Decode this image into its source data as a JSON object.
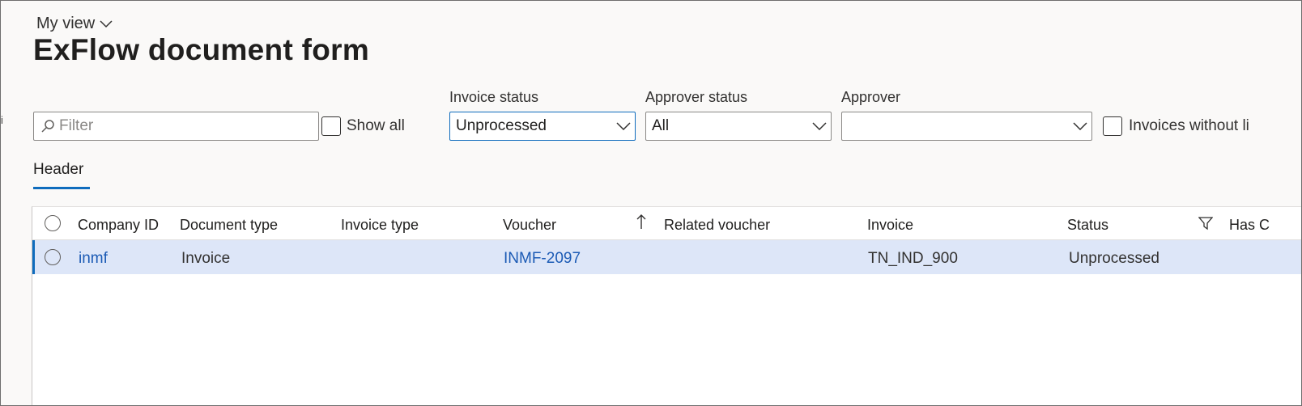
{
  "view_selector": {
    "label": "My view"
  },
  "page_title": "ExFlow document form",
  "filter": {
    "placeholder": "Filter"
  },
  "show_all": {
    "label": "Show all"
  },
  "invoice_status": {
    "label": "Invoice status",
    "value": "Unprocessed"
  },
  "approver_status": {
    "label": "Approver status",
    "value": "All"
  },
  "approver": {
    "label": "Approver",
    "value": ""
  },
  "invoices_without_lines": {
    "label": "Invoices without li"
  },
  "tabs": [
    {
      "label": "Header",
      "active": true
    }
  ],
  "grid": {
    "columns": [
      "Company ID",
      "Document type",
      "Invoice type",
      "Voucher",
      "Related voucher",
      "Invoice",
      "Status",
      "Has C"
    ],
    "rows": [
      {
        "company_id": "inmf",
        "document_type": "Invoice",
        "invoice_type": "",
        "voucher": "INMF-2097",
        "related_voucher": "",
        "invoice": "TN_IND_900",
        "status": "Unprocessed"
      }
    ]
  },
  "colors": {
    "accent": "#0f6cbd",
    "selected_row": "#dde6f8",
    "link": "#1c5bb5"
  }
}
